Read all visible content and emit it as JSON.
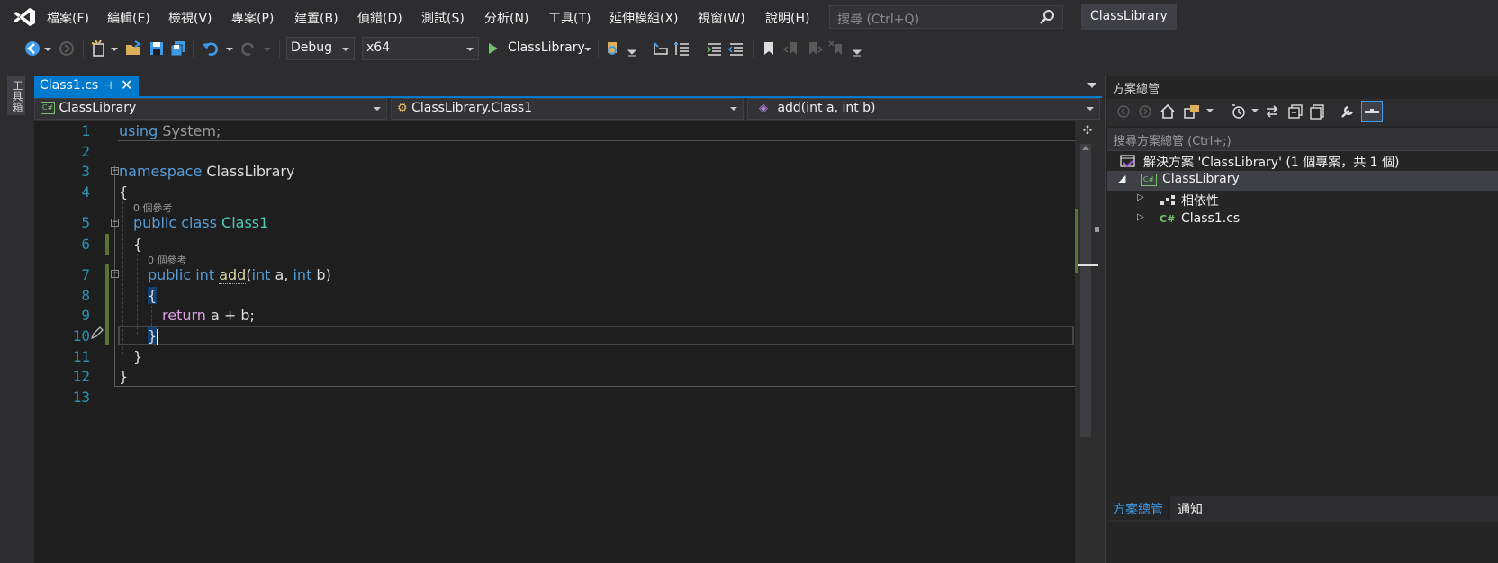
{
  "menu": [
    "檔案(F)",
    "編輯(E)",
    "檢視(V)",
    "專案(P)",
    "建置(B)",
    "偵錯(D)",
    "測試(S)",
    "分析(N)",
    "工具(T)",
    "延伸模組(X)",
    "視窗(W)",
    "說明(H)"
  ],
  "search": {
    "placeholder": "搜尋 (Ctrl+Q)"
  },
  "title": "ClassLibrary",
  "toolbar": {
    "config": "Debug",
    "platform": "x64",
    "start_label": "ClassLibrary"
  },
  "toolbox_label": "工具箱",
  "tab": {
    "label": "Class1.cs",
    "pin": "⊣",
    "close": "✕"
  },
  "nav": {
    "project": "ClassLibrary",
    "class": "ClassLibrary.Class1",
    "member": "add(int a, int b)"
  },
  "code": {
    "line_numbers": [
      "1",
      "2",
      "3",
      "4",
      "5",
      "6",
      "7",
      "8",
      "9",
      "10",
      "11",
      "12",
      "13"
    ],
    "kw_using": "using",
    "system": " System;",
    "kw_namespace": "namespace",
    "namespace_name": " ClassLibrary",
    "open_brace": "{",
    "close_brace": "}",
    "lens_refs": "0 個參考",
    "kw_public": "public",
    "kw_class": "class",
    "class_name": "Class1",
    "kw_int": "int",
    "method_name": "add",
    "param_a": " a, ",
    "param_b": " b)",
    "paren_open": "(",
    "kw_return": "return",
    "return_expr": " a + b;"
  },
  "solution_explorer": {
    "title": "方案總管",
    "search_placeholder": "搜尋方案總管 (Ctrl+;)",
    "solution": "解決方案 'ClassLibrary' (1 個專案，共 1 個)",
    "project": "ClassLibrary",
    "dependencies": "相依性",
    "file": "Class1.cs",
    "tabs": {
      "solution": "方案總管",
      "notifications": "通知"
    }
  },
  "colors": {
    "accent": "#007acc",
    "keyword": "#569cd6",
    "type": "#4ec9b0",
    "method": "#dcdcaa",
    "control": "#d8a0df",
    "line_number": "#2b91af"
  }
}
